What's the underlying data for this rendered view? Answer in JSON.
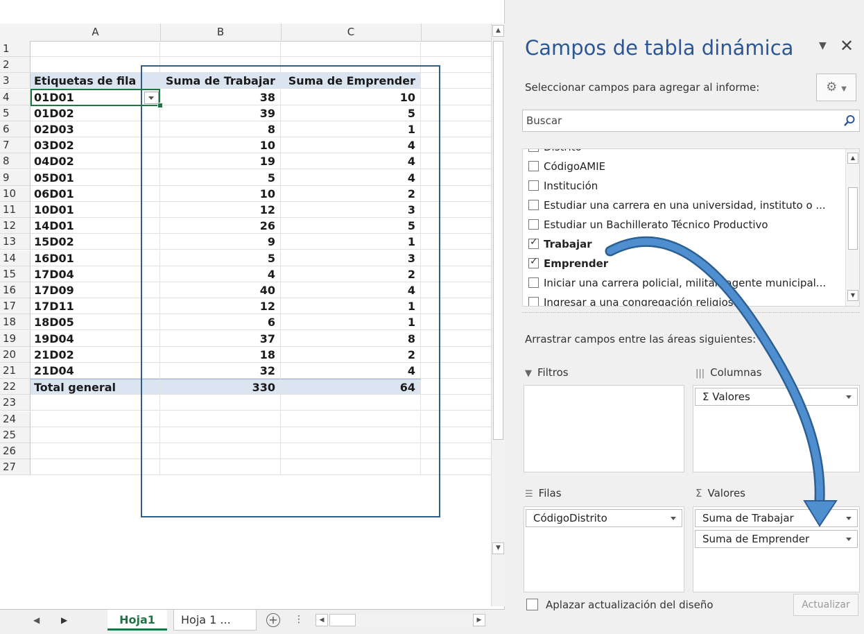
{
  "sheet": {
    "columns": [
      "A",
      "B",
      "C"
    ],
    "row_numbers": [
      "1",
      "2",
      "3",
      "4",
      "5",
      "6",
      "7",
      "8",
      "9",
      "10",
      "11",
      "12",
      "13",
      "14",
      "15",
      "16",
      "17",
      "18",
      "19",
      "20",
      "21",
      "22",
      "23",
      "24",
      "25",
      "26",
      "27"
    ],
    "pivot_header": {
      "row_label": "Etiquetas de fila",
      "col_b": "Suma de Trabajar",
      "col_c": "Suma de Emprender"
    },
    "pivot_rows": [
      {
        "label": "01D01",
        "trabajar": "38",
        "emprender": "10"
      },
      {
        "label": "01D02",
        "trabajar": "39",
        "emprender": "5"
      },
      {
        "label": "02D03",
        "trabajar": "8",
        "emprender": "1"
      },
      {
        "label": "03D02",
        "trabajar": "10",
        "emprender": "4"
      },
      {
        "label": "04D02",
        "trabajar": "19",
        "emprender": "4"
      },
      {
        "label": "05D01",
        "trabajar": "5",
        "emprender": "4"
      },
      {
        "label": "06D01",
        "trabajar": "10",
        "emprender": "2"
      },
      {
        "label": "10D01",
        "trabajar": "12",
        "emprender": "3"
      },
      {
        "label": "14D01",
        "trabajar": "26",
        "emprender": "5"
      },
      {
        "label": "15D02",
        "trabajar": "9",
        "emprender": "1"
      },
      {
        "label": "16D01",
        "trabajar": "5",
        "emprender": "3"
      },
      {
        "label": "17D04",
        "trabajar": "4",
        "emprender": "2"
      },
      {
        "label": "17D09",
        "trabajar": "40",
        "emprender": "4"
      },
      {
        "label": "17D11",
        "trabajar": "12",
        "emprender": "1"
      },
      {
        "label": "18D05",
        "trabajar": "6",
        "emprender": "1"
      },
      {
        "label": "19D04",
        "trabajar": "37",
        "emprender": "8"
      },
      {
        "label": "21D02",
        "trabajar": "18",
        "emprender": "2"
      },
      {
        "label": "21D04",
        "trabajar": "32",
        "emprender": "4"
      }
    ],
    "total": {
      "label": "Total general",
      "trabajar": "330",
      "emprender": "64"
    },
    "tabs": {
      "active": "Hoja1",
      "other": "Hoja 1 ..."
    }
  },
  "pane": {
    "title": "Campos de tabla dinámica",
    "subtitle": "Seleccionar campos para agregar al informe:",
    "search_placeholder": "Buscar",
    "fields": [
      {
        "label": "Distrito",
        "checked": false
      },
      {
        "label": "CódigoAMIE",
        "checked": false
      },
      {
        "label": "Institución",
        "checked": false
      },
      {
        "label": "Estudiar una carrera en una universidad, instituto o ...",
        "checked": false
      },
      {
        "label": "Estudiar un Bachillerato Técnico Productivo",
        "checked": false
      },
      {
        "label": "Trabajar",
        "checked": true
      },
      {
        "label": "Emprender",
        "checked": true
      },
      {
        "label": "Iniciar una carrera policial, militar, agente municipal...",
        "checked": false
      },
      {
        "label": "Ingresar a una congregación religiosa",
        "checked": false
      }
    ],
    "drag_label": "Arrastrar campos entre las áreas siguientes:",
    "areas": {
      "filters": "Filtros",
      "columns": "Columnas",
      "rows": "Filas",
      "values": "Valores"
    },
    "columns_items": [
      "Σ Valores"
    ],
    "rows_items": [
      "CódigoDistrito"
    ],
    "values_items": [
      "Suma de Trabajar",
      "Suma de Emprender"
    ],
    "defer_label": "Aplazar actualización del diseño",
    "update_button": "Actualizar",
    "accent_color": "#2b5797",
    "arrow_color": "#3b7fc4"
  }
}
